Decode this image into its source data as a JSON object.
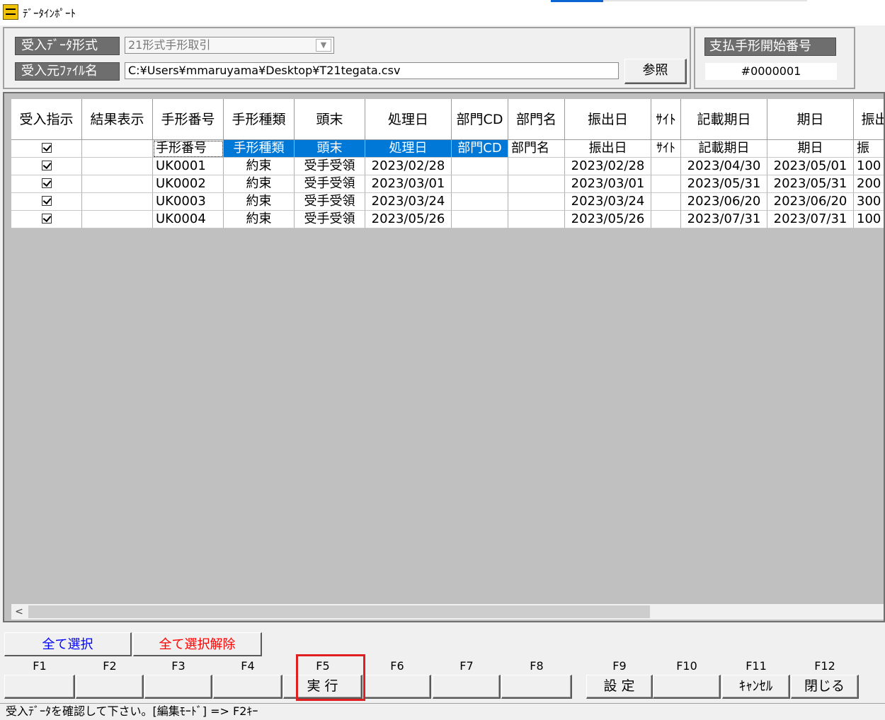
{
  "window": {
    "title": "ﾃﾞｰﾀｲﾝﾎﾟｰﾄ"
  },
  "form": {
    "format_label": "受入ﾃﾞｰﾀ形式",
    "format_value": "21形式手形取引",
    "file_label": "受入元ﾌｧｲﾙ名",
    "file_value": "C:¥Users¥mmaruyama¥Desktop¥T21tegata.csv",
    "browse_button": "参照"
  },
  "start_number": {
    "label": "支払手形開始番号",
    "value": "#0000001"
  },
  "grid": {
    "columns": [
      "受入指示",
      "結果表示",
      "手形番号",
      "手形種類",
      "頭末",
      "処理日",
      "部門CD",
      "部門名",
      "振出日",
      "ｻｲﾄ",
      "記載期日",
      "期日",
      "振出"
    ],
    "mapping_row": [
      "",
      "",
      "手形番号",
      "手形種類",
      "頭末",
      "処理日",
      "部門CD",
      "部門名",
      "振出日",
      "ｻｲﾄ",
      "記載期日",
      "期日",
      "振"
    ],
    "rows": [
      [
        "",
        "",
        "UK0001",
        "約束",
        "受手受領",
        "2023/02/28",
        "",
        "",
        "2023/02/28",
        "",
        "2023/04/30",
        "2023/05/01",
        "100"
      ],
      [
        "",
        "",
        "UK0002",
        "約束",
        "受手受領",
        "2023/03/01",
        "",
        "",
        "2023/03/01",
        "",
        "2023/05/31",
        "2023/05/31",
        "200"
      ],
      [
        "",
        "",
        "UK0003",
        "約束",
        "受手受領",
        "2023/03/24",
        "",
        "",
        "2023/03/24",
        "",
        "2023/06/20",
        "2023/06/20",
        "300"
      ],
      [
        "",
        "",
        "UK0004",
        "約束",
        "受手受領",
        "2023/05/26",
        "",
        "",
        "2023/05/26",
        "",
        "2023/07/31",
        "2023/07/31",
        "100"
      ]
    ]
  },
  "selection": {
    "select_all": "全て選択",
    "deselect_all": "全て選択解除",
    "select_all_color": "#0000ff",
    "deselect_all_color": "#ff0000"
  },
  "fkeys": [
    {
      "key": "F1",
      "label": ""
    },
    {
      "key": "F2",
      "label": ""
    },
    {
      "key": "F3",
      "label": ""
    },
    {
      "key": "F4",
      "label": ""
    },
    {
      "key": "F5",
      "label": "実 行"
    },
    {
      "key": "F6",
      "label": ""
    },
    {
      "key": "F7",
      "label": ""
    },
    {
      "key": "F8",
      "label": ""
    },
    {
      "key": "F9",
      "label": "設 定"
    },
    {
      "key": "F10",
      "label": ""
    },
    {
      "key": "F11",
      "label": "ｷｬﾝｾﾙ"
    },
    {
      "key": "F12",
      "label": "閉じる"
    }
  ],
  "status": {
    "message": "受入ﾃﾞｰﾀを確認して下さい。[編集ﾓｰﾄﾞ] => F2ｷｰ"
  },
  "colors": {
    "selection": "#0078d7",
    "label_bg": "#6e6e6e",
    "highlight": "#e02020"
  }
}
